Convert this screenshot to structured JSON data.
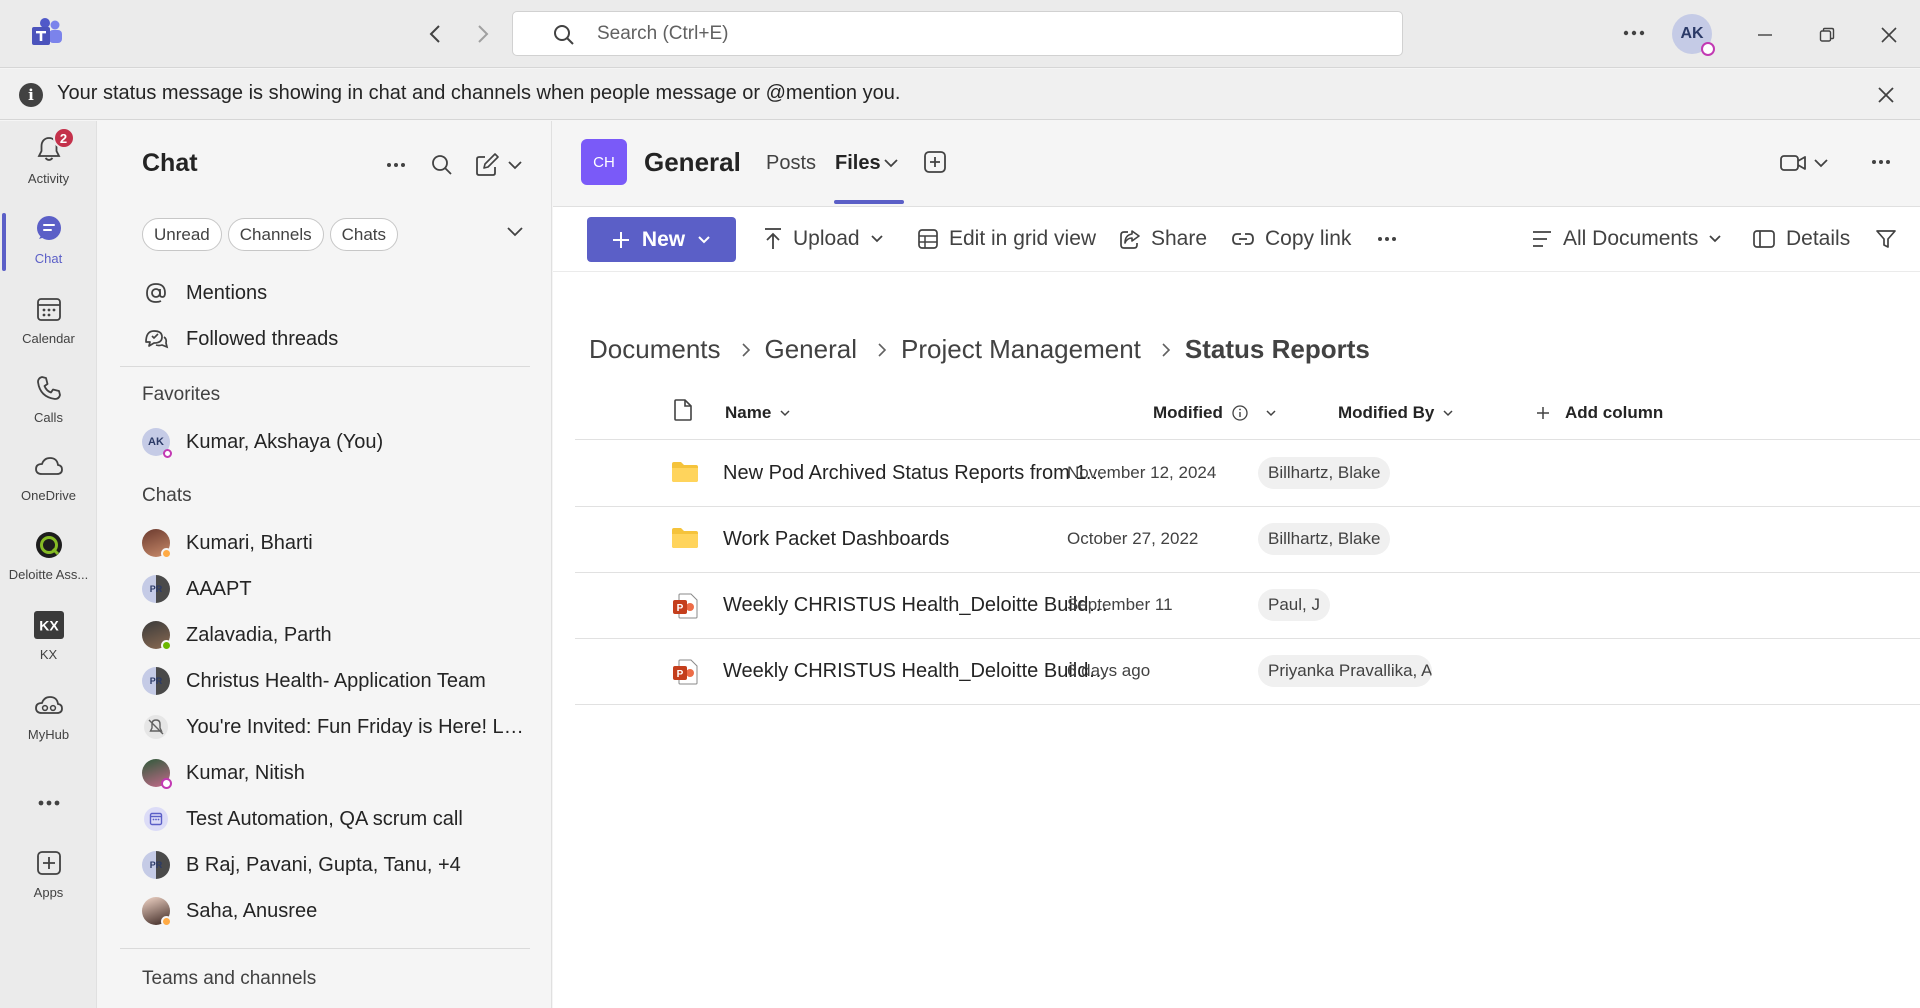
{
  "search": {
    "placeholder": "Search (Ctrl+E)"
  },
  "user": {
    "initials": "AK"
  },
  "banner": {
    "text": "Your status message is showing in chat and channels when people message or @mention you."
  },
  "rail": [
    {
      "label": "Activity",
      "badge": "2"
    },
    {
      "label": "Chat"
    },
    {
      "label": "Calendar"
    },
    {
      "label": "Calls"
    },
    {
      "label": "OneDrive"
    },
    {
      "label": "Deloitte Ass..."
    },
    {
      "label": "KX"
    },
    {
      "label": "MyHub"
    },
    {
      "label": "Apps"
    }
  ],
  "chatpane": {
    "title": "Chat",
    "filters": [
      "Unread",
      "Channels",
      "Chats"
    ],
    "quick": [
      "Mentions",
      "Followed threads"
    ],
    "favorites_header": "Favorites",
    "favorites": [
      {
        "name": "Kumar, Akshaya (You)",
        "initials": "AK"
      }
    ],
    "chats_header": "Chats",
    "chats": [
      {
        "name": "Kumari, Bharti"
      },
      {
        "name": "AAAPT",
        "initials": "PR"
      },
      {
        "name": "Zalavadia, Parth"
      },
      {
        "name": "Christus Health- Application Team",
        "initials": "PR"
      },
      {
        "name": "You're Invited: Fun Friday is Here! Let..."
      },
      {
        "name": "Kumar, Nitish"
      },
      {
        "name": "Test Automation, QA scrum call"
      },
      {
        "name": "B Raj, Pavani, Gupta, Tanu, +4",
        "initials": "PR"
      },
      {
        "name": "Saha, Anusree"
      }
    ],
    "teams_header": "Teams and channels"
  },
  "channel": {
    "avatar": "CH",
    "name": "General",
    "tabs": [
      "Posts",
      "Files"
    ]
  },
  "toolbar": {
    "new": "New",
    "upload": "Upload",
    "grid": "Edit in grid view",
    "share": "Share",
    "copy": "Copy link",
    "view": "All Documents",
    "details": "Details"
  },
  "breadcrumb": [
    "Documents",
    "General",
    "Project Management",
    "Status Reports"
  ],
  "table": {
    "headers": {
      "name": "Name",
      "modified": "Modified",
      "modified_by": "Modified By",
      "add": "Add column"
    },
    "rows": [
      {
        "type": "folder",
        "name": "New Pod Archived Status Reports from 11_...",
        "modified": "November 12, 2024",
        "by": "Billhartz, Blake"
      },
      {
        "type": "folder",
        "name": "Work Packet Dashboards",
        "modified": "October 27, 2022",
        "by": "Billhartz, Blake"
      },
      {
        "type": "pptx",
        "name": "Weekly CHRISTUS Health_Deloitte Build Te...",
        "modified": "September 11",
        "by": "Paul, J"
      },
      {
        "type": "pptx",
        "name": "Weekly CHRISTUS Health_Deloitte Build Te...",
        "modified": "6 days ago",
        "by": "Priyanka Pravallika, Ac"
      }
    ]
  },
  "colors": {
    "accent": "#5b5fc7",
    "badge": "#c4314b",
    "folder": "#f5c33b",
    "pptx": "#c43e1c"
  }
}
